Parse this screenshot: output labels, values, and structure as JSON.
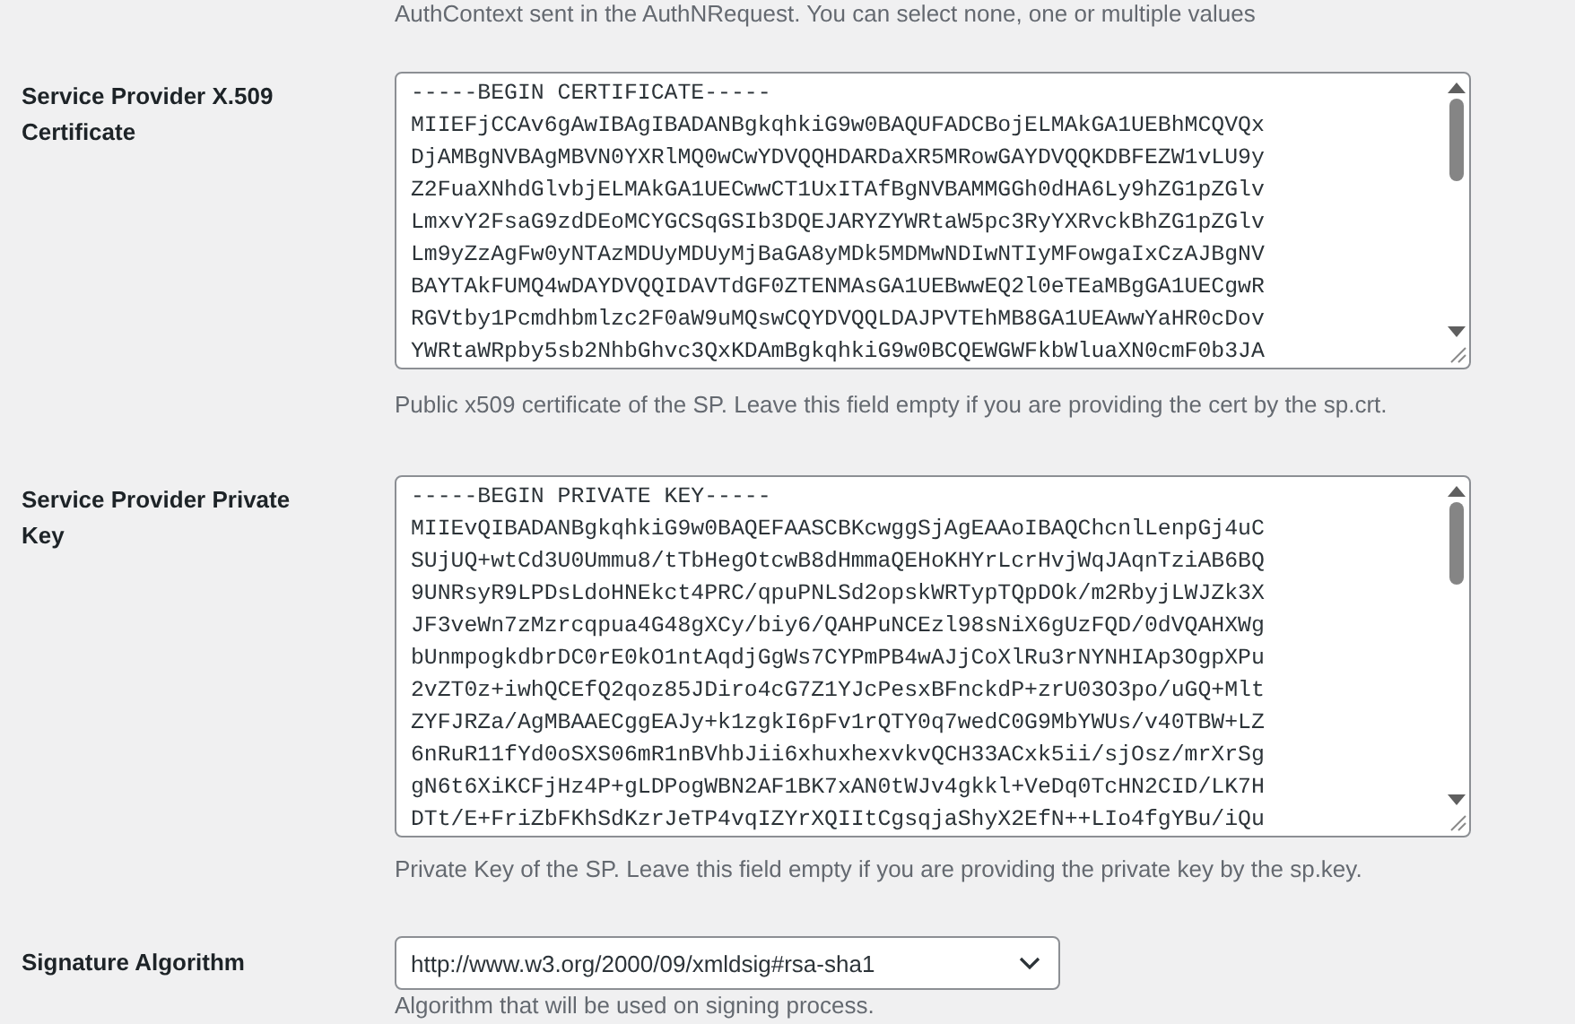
{
  "top_description": "AuthContext sent in the AuthNRequest. You can select none, one or multiple values",
  "fields": [
    {
      "kind": "textarea",
      "label": "Service Provider X.509 Certificate",
      "lines": [
        "-----BEGIN CERTIFICATE-----",
        "MIIEFjCCAv6gAwIBAgIBADANBgkqhkiG9w0BAQUFADCBojELMAkGA1UEBhMCQVQx",
        "DjAMBgNVBAgMBVN0YXRlMQ0wCwYDVQQHDARDaXR5MRowGAYDVQQKDBFEZW1vLU9y",
        "Z2FuaXNhdGlvbjELMAkGA1UECwwCT1UxITAfBgNVBAMMGGh0dHA6Ly9hZG1pZGlv",
        "LmxvY2FsaG9zdDEoMCYGCSqGSIb3DQEJARYZYWRtaW5pc3RyYXRvckBhZG1pZGlv",
        "Lm9yZzAgFw0yNTAzMDUyMDUyMjBaGA8yMDk5MDMwNDIwNTIyMFowgaIxCzAJBgNV",
        "BAYTAkFUMQ4wDAYDVQQIDAVTdGF0ZTENMAsGA1UEBwwEQ2l0eTEaMBgGA1UECgwR",
        "RGVtby1Pcmdhbmlzc2F0aW9uMQswCQYDVQQLDAJPVTEhMB8GA1UEAwwYaHR0cDov",
        "YWRtaWRpby5sb2NhbGhvc3QxKDAmBgkqhkiG9w0BCQEWGWFkbWluaXN0cmF0b3JA"
      ],
      "description": "Public x509 certificate of the SP. Leave this field empty if you are providing the cert by the sp.crt."
    },
    {
      "kind": "textarea",
      "label": "Service Provider Private Key",
      "lines": [
        "-----BEGIN PRIVATE KEY-----",
        "MIIEvQIBADANBgkqhkiG9w0BAQEFAASCBKcwggSjAgEAAoIBAQChcnlLenpGj4uC",
        "SUjUQ+wtCd3U0Ummu8/tTbHegOtcwB8dHmmaQEHoKHYrLcrHvjWqJAqnTziAB6BQ",
        "9UNRsyR9LPDsLdoHNEkct4PRC/qpuPNLSd2opskWRTypTQpDOk/m2RbyjLWJZk3X",
        "JF3veWn7zMzrcqpua4G48gXCy/biy6/QAHPuNCEzl98sNiX6gUzFQD/0dVQAHXWg",
        "bUnmpogkdbrDC0rE0kO1ntAqdjGgWs7CYPmPB4wAJjCoXlRu3rNYNHIAp3OgpXPu",
        "2vZT0z+iwhQCEfQ2qoz85JDiro4cG7Z1YJcPesxBFnckdP+zrU03O3po/uGQ+Mlt",
        "ZYFJRZa/AgMBAAECggEAJy+k1zgkI6pFv1rQTY0q7wedC0G9MbYWUs/v40TBW+LZ",
        "6nRuR11fYd0oSXS06mR1nBVhbJii6xhuxhexvkvQCH33ACxk5ii/sjOsz/mrXrSg",
        "gN6t6XiKCFjHz4P+gLDPogWBN2AF1BK7xAN0tWJv4gkkl+VeDq0TcHN2CID/LK7H",
        "DTt/E+FriZbFKhSdKzrJeTP4vqIZYrXQIItCgsqjaShyX2EfN++LIo4fgYBu/iQu"
      ],
      "description": "Private Key of the SP. Leave this field empty if you are providing the private key by the sp.key."
    },
    {
      "kind": "select",
      "label": "Signature Algorithm",
      "value": "http://www.w3.org/2000/09/xmldsig#rsa-sha1",
      "description": "Algorithm that will be used on signing process."
    }
  ]
}
